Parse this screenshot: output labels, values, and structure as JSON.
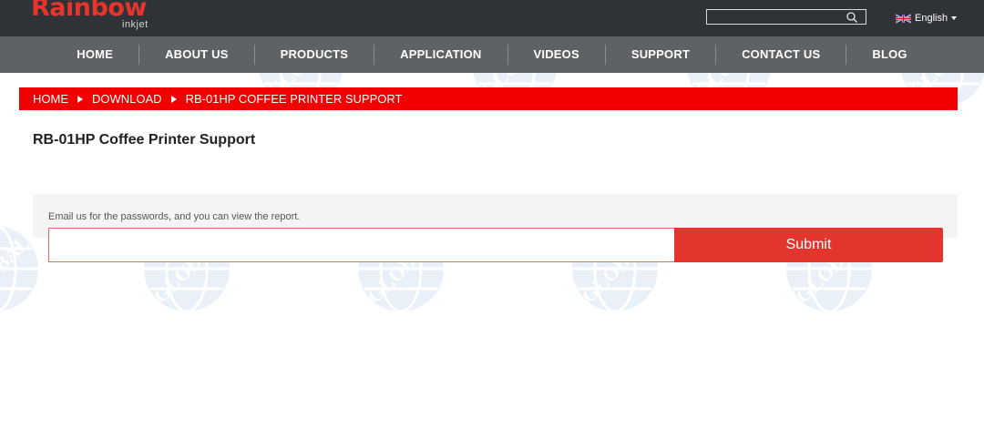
{
  "brand": {
    "logo_text": "Rainbow",
    "logo_sub": "inkjet",
    "accent_color": "#f20000",
    "button_color": "#e3342e"
  },
  "header": {
    "search": {
      "value": "",
      "placeholder": ""
    },
    "language": {
      "label": "English",
      "flag_icon": "uk-flag-icon"
    }
  },
  "nav": {
    "items": [
      {
        "label": "HOME"
      },
      {
        "label": "ABOUT US"
      },
      {
        "label": "PRODUCTS"
      },
      {
        "label": "APPLICATION"
      },
      {
        "label": "VIDEOS"
      },
      {
        "label": "SUPPORT"
      },
      {
        "label": "CONTACT US"
      },
      {
        "label": "BLOG"
      }
    ]
  },
  "breadcrumb": {
    "items": [
      {
        "label": "HOME"
      },
      {
        "label": "DOWNLOAD"
      },
      {
        "label": "RB-01HP COFFEE PRINTER SUPPORT"
      }
    ]
  },
  "main": {
    "title": "RB-01HP Coffee Printer Support",
    "note": "Email us for the passwords, and you can view the report.",
    "password_value": "",
    "password_placeholder": "",
    "submit_label": "Submit"
  },
  "watermark": {
    "text": "GLOBAL"
  }
}
